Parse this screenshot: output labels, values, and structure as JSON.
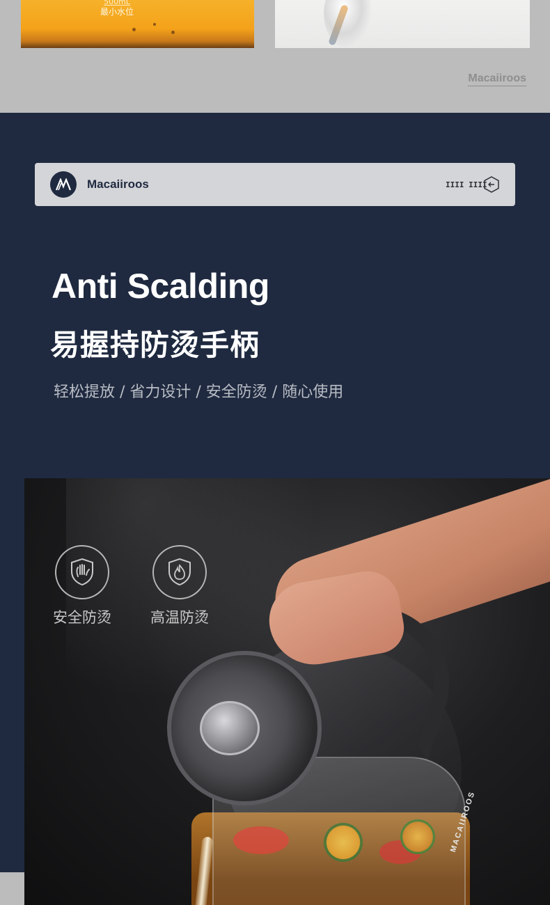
{
  "top_section": {
    "left_photo_caption_volume": "500mL",
    "left_photo_caption_text": "最小水位",
    "watermark": "Macaiiroos"
  },
  "header": {
    "brand": "Macaiiroos",
    "marks": "IIII IIII"
  },
  "hero": {
    "title_en": "Anti Scalding",
    "title_cn": "易握持防烫手柄",
    "subtitle": "轻松提放 / 省力设计 / 安全防烫 / 随心使用"
  },
  "features": [
    {
      "label": "安全防烫",
      "icon": "hand-shield-icon"
    },
    {
      "label": "高温防烫",
      "icon": "flame-shield-icon"
    }
  ],
  "product": {
    "brand_on_kettle": "MACAIIROOS"
  },
  "colors": {
    "background": "#1f2a40",
    "gray_band": "#bcbcbc",
    "header_bar": "#d4d5d8"
  }
}
